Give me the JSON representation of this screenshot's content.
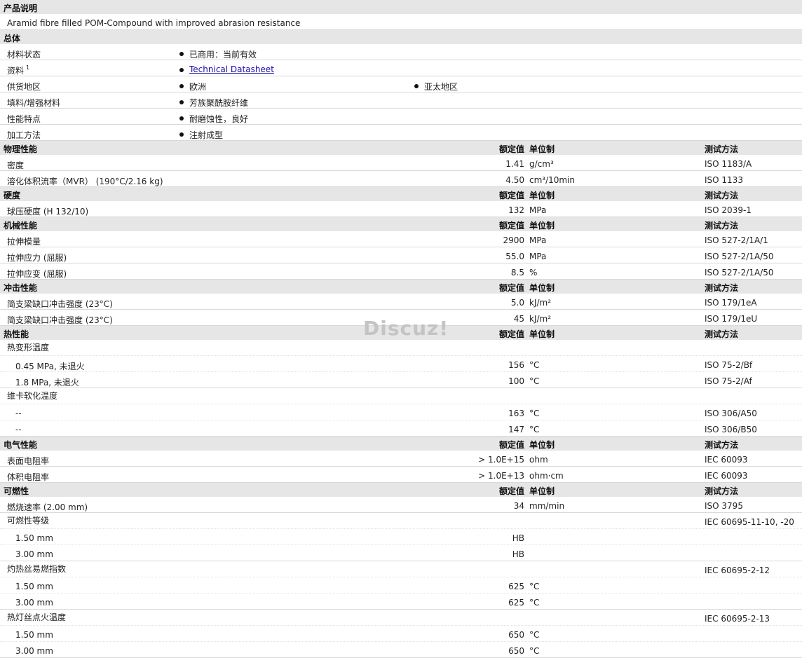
{
  "description": {
    "header": "产品说明",
    "text": "Aramid fibre filled POM-Compound with improved abrasion resistance"
  },
  "general": {
    "header": "总体",
    "rows": [
      {
        "label": "材料状态",
        "values": [
          "已商用：当前有效"
        ]
      },
      {
        "label": "资料",
        "sup": "1",
        "values": [
          "Technical Datasheet"
        ],
        "link": true
      },
      {
        "label": "供货地区",
        "values": [
          "欧洲",
          "亚太地区"
        ]
      },
      {
        "label": "填料/增强材料",
        "values": [
          "芳族聚酰胺纤维"
        ]
      },
      {
        "label": "性能特点",
        "values": [
          "耐磨蚀性，良好"
        ]
      },
      {
        "label": "加工方法",
        "values": [
          "注射成型"
        ]
      }
    ]
  },
  "col_headers": {
    "value": "额定值",
    "unit": "单位制",
    "method": "测试方法"
  },
  "sections": [
    {
      "header": "物理性能",
      "rows": [
        {
          "label": "密度",
          "value": "1.41",
          "unit": "g/cm³",
          "method": "ISO 1183/A"
        },
        {
          "label": "溶化体积流率（MVR） (190°C/2.16 kg)",
          "value": "4.50",
          "unit": "cm³/10min",
          "method": "ISO 1133"
        }
      ]
    },
    {
      "header": "硬度",
      "rows": [
        {
          "label": "球压硬度 (H 132/10)",
          "value": "132",
          "unit": "MPa",
          "method": "ISO 2039-1"
        }
      ]
    },
    {
      "header": "机械性能",
      "rows": [
        {
          "label": "拉伸模量",
          "value": "2900",
          "unit": "MPa",
          "method": "ISO 527-2/1A/1"
        },
        {
          "label": "拉伸应力 (屈服)",
          "value": "55.0",
          "unit": "MPa",
          "method": "ISO 527-2/1A/50"
        },
        {
          "label": "拉伸应变 (屈服)",
          "value": "8.5",
          "unit": "%",
          "method": "ISO 527-2/1A/50"
        }
      ]
    },
    {
      "header": "冲击性能",
      "rows": [
        {
          "label": "简支梁缺口冲击强度 (23°C)",
          "value": "5.0",
          "unit": "kJ/m²",
          "method": "ISO 179/1eA"
        },
        {
          "label": "简支梁缺口冲击强度 (23°C)",
          "value": "45",
          "unit": "kJ/m²",
          "method": "ISO 179/1eU"
        }
      ]
    },
    {
      "header": "热性能",
      "rows": [
        {
          "label": "热变形温度",
          "value": "",
          "unit": "",
          "method": "",
          "group": true
        },
        {
          "label": "0.45 MPa, 未退火",
          "value": "156",
          "unit": "°C",
          "method": "ISO 75-2/Bf",
          "sub": true,
          "dotted": true
        },
        {
          "label": "1.8 MPa, 未退火",
          "value": "100",
          "unit": "°C",
          "method": "ISO 75-2/Af",
          "sub": true
        },
        {
          "label": "维卡软化温度",
          "value": "",
          "unit": "",
          "method": "",
          "group": true
        },
        {
          "label": "--",
          "value": "163",
          "unit": "°C",
          "method": "ISO 306/A50",
          "sub": true,
          "dotted": true
        },
        {
          "label": "--",
          "value": "147",
          "unit": "°C",
          "method": "ISO 306/B50",
          "sub": true
        }
      ]
    },
    {
      "header": "电气性能",
      "rows": [
        {
          "label": "表面电阻率",
          "value": "> 1.0E+15",
          "unit": "ohm",
          "method": "IEC 60093"
        },
        {
          "label": "体积电阻率",
          "value": "> 1.0E+13",
          "unit": "ohm·cm",
          "method": "IEC 60093"
        }
      ]
    },
    {
      "header": "可燃性",
      "rows": [
        {
          "label": "燃烧速率 (2.00 mm)",
          "value": "34",
          "unit": "mm/min",
          "method": "ISO 3795"
        },
        {
          "label": "可燃性等级",
          "value": "",
          "unit": "",
          "method": "IEC 60695-11-10, -20",
          "group": true
        },
        {
          "label": "1.50 mm",
          "value": "HB",
          "unit": "",
          "method": "",
          "sub": true,
          "dotted": true
        },
        {
          "label": "3.00 mm",
          "value": "HB",
          "unit": "",
          "method": "",
          "sub": true
        },
        {
          "label": "灼热丝易燃指数",
          "value": "",
          "unit": "",
          "method": "IEC 60695-2-12",
          "group": true
        },
        {
          "label": "1.50 mm",
          "value": "625",
          "unit": "°C",
          "method": "",
          "sub": true,
          "dotted": true
        },
        {
          "label": "3.00 mm",
          "value": "625",
          "unit": "°C",
          "method": "",
          "sub": true
        },
        {
          "label": "热灯丝点火温度",
          "value": "",
          "unit": "",
          "method": "IEC 60695-2-13",
          "group": true
        },
        {
          "label": "1.50 mm",
          "value": "650",
          "unit": "°C",
          "method": "",
          "sub": true,
          "dotted": true
        },
        {
          "label": "3.00 mm",
          "value": "650",
          "unit": "°C",
          "method": "",
          "sub": true
        }
      ]
    }
  ],
  "watermark": "Discuz!"
}
